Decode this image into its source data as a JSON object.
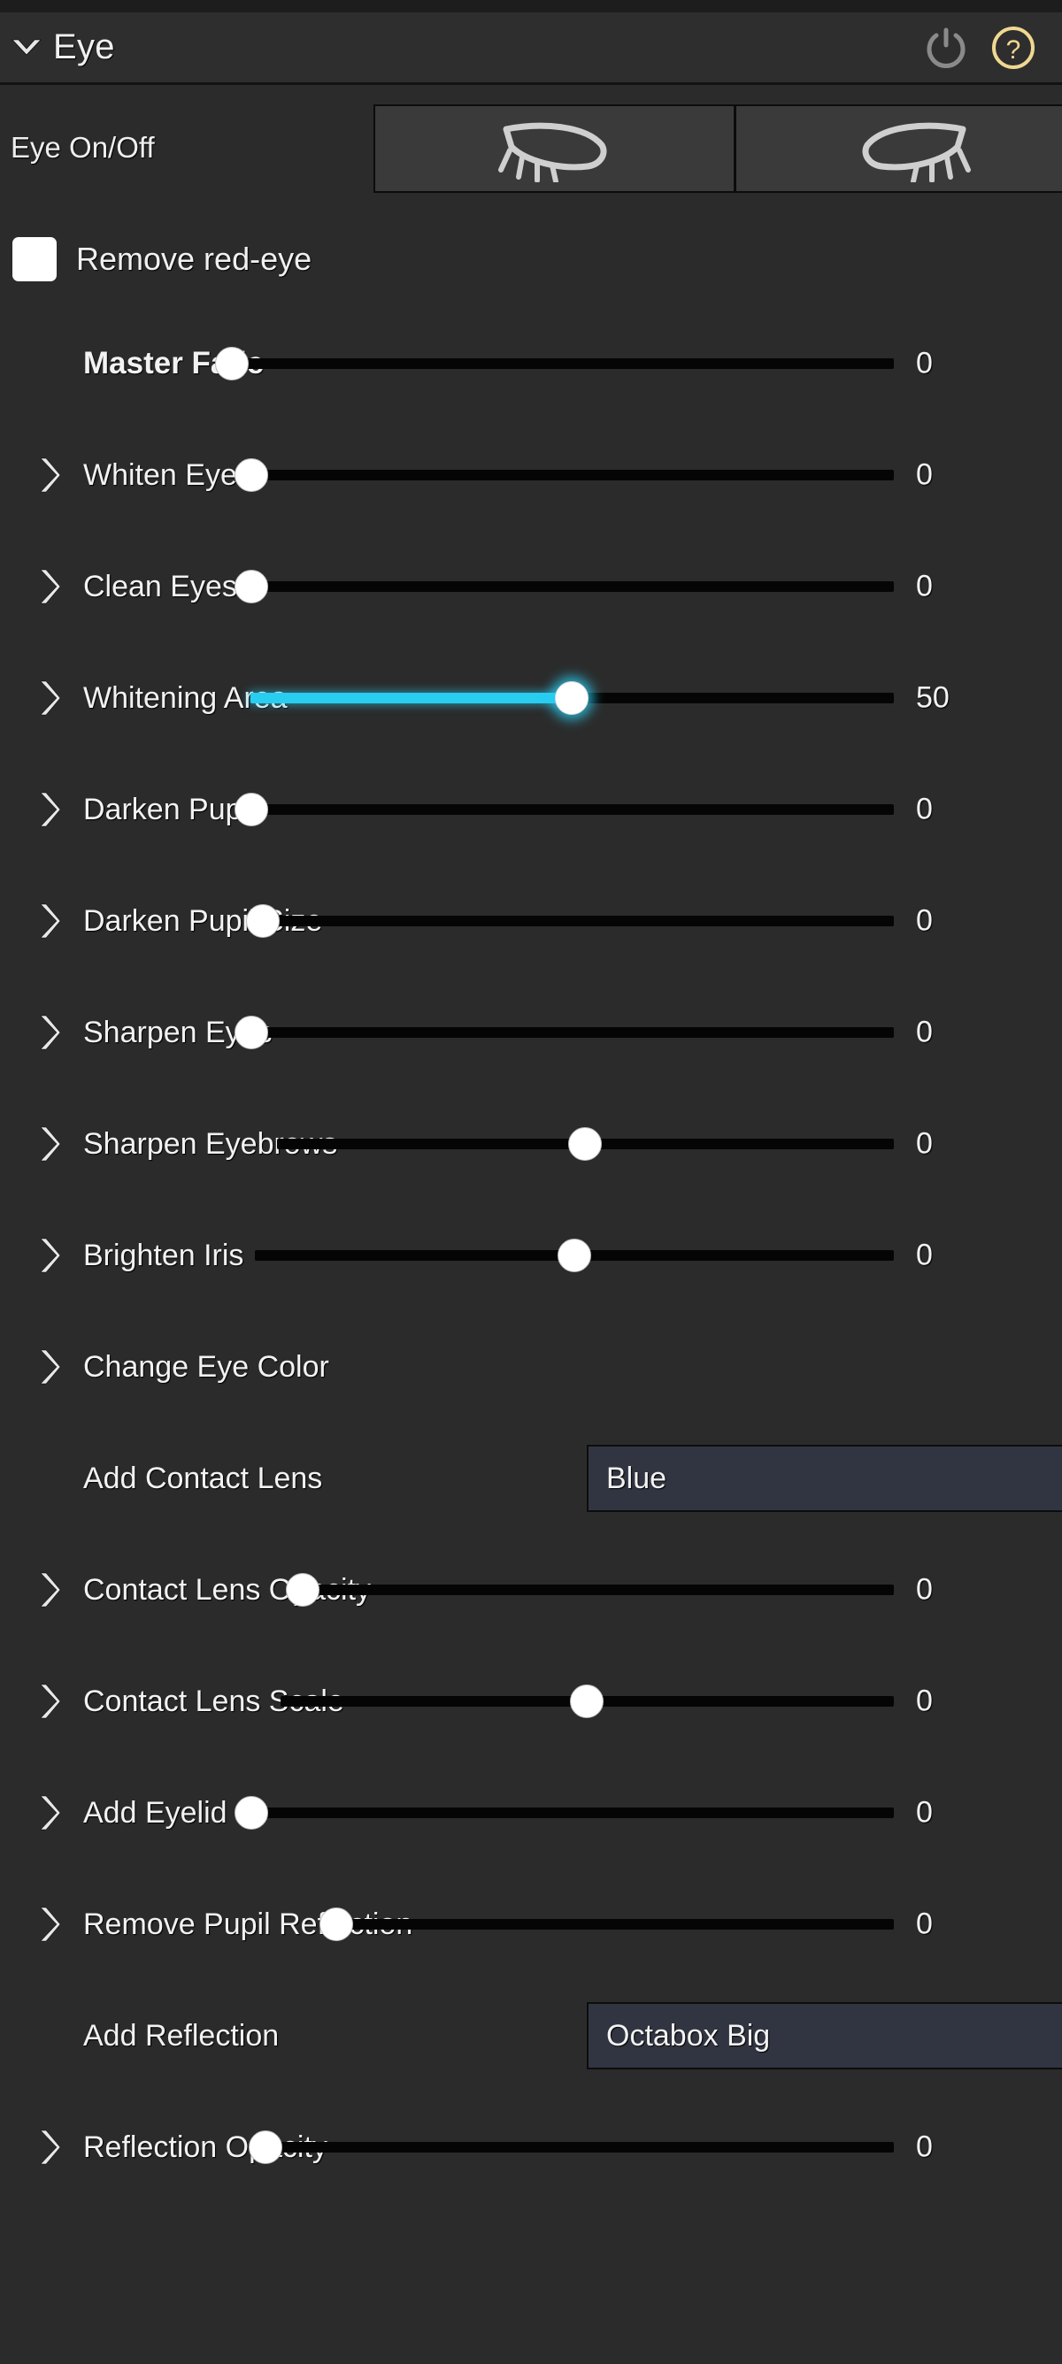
{
  "panel": {
    "title": "Eye",
    "collapse_icon": "chevron-down-icon",
    "power_icon": "power-icon",
    "help_icon": "help-question-icon",
    "accent_color": "#29cdf0",
    "help_color": "#f0d890",
    "background_color": "#2b2b2b"
  },
  "eye_on_off": {
    "label": "Eye On/Off",
    "buttons": [
      {
        "name": "left-eye-toggle",
        "icon": "eye-left-icon"
      },
      {
        "name": "right-eye-toggle",
        "icon": "eye-right-icon"
      }
    ]
  },
  "remove_red_eye": {
    "label": "Remove red-eye",
    "checked": false
  },
  "controls": [
    {
      "label": "Master Fade",
      "value": "0",
      "bold": true,
      "expandable": false,
      "track_start": 255,
      "track_end": 1010,
      "handle": 262,
      "fill": 0
    },
    {
      "label": "Whiten Eyes",
      "value": "0",
      "bold": false,
      "expandable": true,
      "track_start": 272,
      "track_end": 1010,
      "handle": 284,
      "fill": 0
    },
    {
      "label": "Clean Eyes",
      "value": "0",
      "bold": false,
      "expandable": true,
      "track_start": 272,
      "track_end": 1010,
      "handle": 284,
      "fill": 0
    },
    {
      "label": "Whitening Area",
      "value": "50",
      "bold": false,
      "expandable": true,
      "track_start": 283,
      "track_end": 1010,
      "handle": 646,
      "fill": 646,
      "active": true
    },
    {
      "label": "Darken Pupil",
      "value": "0",
      "bold": false,
      "expandable": true,
      "track_start": 272,
      "track_end": 1010,
      "handle": 284,
      "fill": 0
    },
    {
      "label": "Darken Pupil Size",
      "value": "0",
      "bold": false,
      "expandable": true,
      "track_start": 285,
      "track_end": 1010,
      "handle": 297,
      "fill": 0
    },
    {
      "label": "Sharpen Eyes",
      "value": "0",
      "bold": false,
      "expandable": true,
      "track_start": 272,
      "track_end": 1010,
      "handle": 284,
      "fill": 0
    },
    {
      "label": "Sharpen Eyebrows",
      "value": "0",
      "bold": false,
      "expandable": true,
      "track_start": 313,
      "track_end": 1010,
      "handle": 661,
      "fill": 0
    },
    {
      "label": "Brighten Iris",
      "value": "0",
      "bold": false,
      "expandable": true,
      "track_start": 288,
      "track_end": 1010,
      "handle": 649,
      "fill": 0
    },
    {
      "label": "Change Eye Color",
      "value": "",
      "bold": false,
      "expandable": true,
      "no_slider": true
    }
  ],
  "contact_lens": {
    "label": "Add Contact Lens",
    "value": "Blue",
    "arrow_icon": "chevron-down-icon"
  },
  "controls2": [
    {
      "label": "Contact Lens Opacity",
      "value": "0",
      "bold": false,
      "expandable": true,
      "track_start": 330,
      "track_end": 1010,
      "handle": 342,
      "fill": 0
    },
    {
      "label": "Contact Lens Scale",
      "value": "0",
      "bold": false,
      "expandable": true,
      "track_start": 317,
      "track_end": 1010,
      "handle": 663,
      "fill": 0
    },
    {
      "label": "Add Eyelid",
      "value": "0",
      "bold": false,
      "expandable": true,
      "track_start": 272,
      "track_end": 1010,
      "handle": 284,
      "fill": 0
    },
    {
      "label": "Remove Pupil Reflection",
      "value": "0",
      "bold": false,
      "expandable": true,
      "track_start": 368,
      "track_end": 1010,
      "handle": 380,
      "fill": 0
    }
  ],
  "reflection": {
    "label": "Add Reflection",
    "value": "Octabox Big",
    "arrow_icon": "chevron-down-icon"
  },
  "controls3": [
    {
      "label": "Reflection Opacity",
      "value": "0",
      "bold": false,
      "expandable": true,
      "track_start": 288,
      "track_end": 1010,
      "handle": 300,
      "fill": 0
    }
  ]
}
